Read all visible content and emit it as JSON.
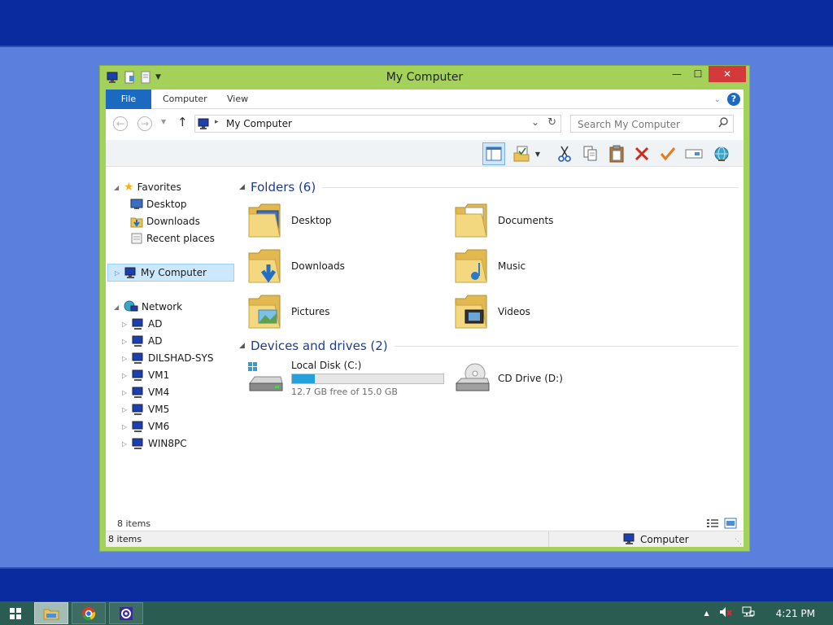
{
  "window": {
    "title": "My Computer",
    "controls": {
      "minimize": "—",
      "maximize": "☐",
      "close": "✕"
    }
  },
  "ribbon": {
    "tabs": [
      {
        "label": "File"
      },
      {
        "label": "Computer"
      },
      {
        "label": "View"
      }
    ]
  },
  "address": {
    "breadcrumb": "My Computer",
    "search_placeholder": "Search My Computer"
  },
  "nav": {
    "favorites": {
      "label": "Favorites",
      "items": [
        {
          "label": "Desktop"
        },
        {
          "label": "Downloads"
        },
        {
          "label": "Recent places"
        }
      ]
    },
    "this_pc": {
      "label": "My Computer"
    },
    "network": {
      "label": "Network",
      "items": [
        {
          "label": "AD"
        },
        {
          "label": "AD"
        },
        {
          "label": "DILSHAD-SYS"
        },
        {
          "label": "VM1"
        },
        {
          "label": "VM4"
        },
        {
          "label": "VM5"
        },
        {
          "label": "VM6"
        },
        {
          "label": "WIN8PC"
        }
      ]
    }
  },
  "content": {
    "folders_header": "Folders (6)",
    "folders": [
      {
        "name": "Desktop",
        "icon": "desktop-folder-icon"
      },
      {
        "name": "Documents",
        "icon": "documents-folder-icon"
      },
      {
        "name": "Downloads",
        "icon": "downloads-folder-icon"
      },
      {
        "name": "Music",
        "icon": "music-folder-icon"
      },
      {
        "name": "Pictures",
        "icon": "pictures-folder-icon"
      },
      {
        "name": "Videos",
        "icon": "videos-folder-icon"
      }
    ],
    "devices_header": "Devices and drives (2)",
    "drives": [
      {
        "name": "Local Disk (C:)",
        "free_text": "12.7 GB free of 15.0 GB",
        "used_fraction": 0.153
      },
      {
        "name": "CD Drive (D:)"
      }
    ]
  },
  "status": {
    "items_inner": "8 items",
    "items": "8 items",
    "location": "Computer"
  },
  "tray": {
    "time": "4:21 PM"
  },
  "colors": {
    "window_frame": "#a4d15a",
    "accent": "#1c69c2",
    "close": "#d43a3a",
    "taskbar": "#2b5c52",
    "desktop": "#5b7fdc",
    "desktop_band": "#0a2aa0"
  }
}
